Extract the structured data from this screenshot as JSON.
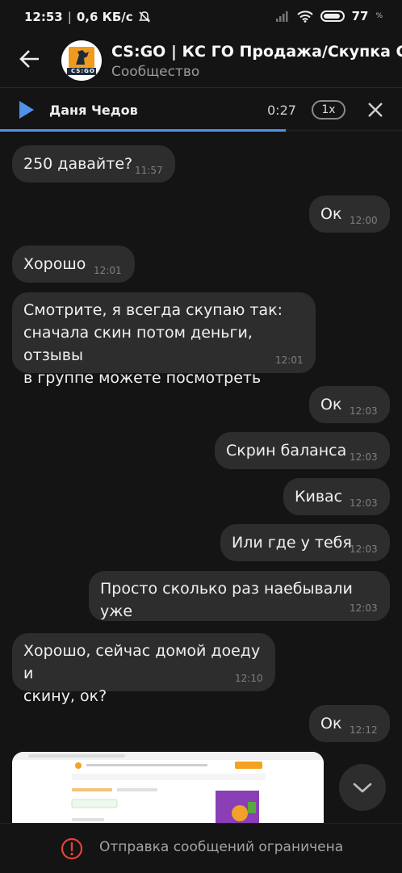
{
  "status_bar": {
    "time": "12:53",
    "speed": "0,6 КБ/с",
    "battery": "77",
    "battery_unit": "%"
  },
  "header": {
    "title": "CS:GO | КС ГО Продажа/Скупка СКИНОВ",
    "subtitle": "Сообщество",
    "avatar_text": "CS:GO"
  },
  "player": {
    "name": "Даня Чедов",
    "time": "0:27",
    "speed": "1x",
    "progress": 0.71
  },
  "messages": [
    {
      "text": "250 давайте?",
      "time": "11:57"
    },
    {
      "text": "Ок",
      "time": "12:00"
    },
    {
      "text": "Хорошо",
      "time": "12:01"
    },
    {
      "text": "Смотрите, я всегда скупаю так:\nсначала скин потом деньги, отзывы\nв группе можете посмотреть",
      "time": "12:01"
    },
    {
      "text": "Ок",
      "time": "12:03"
    },
    {
      "text": "Скрин баланса",
      "time": "12:03"
    },
    {
      "text": "Кивас",
      "time": "12:03"
    },
    {
      "text": "Или где у тебя",
      "time": "12:03"
    },
    {
      "text": "Просто сколько раз наебывали уже",
      "time": "12:03"
    },
    {
      "text": "Хорошо, сейчас домой доеду и\nскину, ок?",
      "time": "12:10"
    },
    {
      "text": "Ок",
      "time": "12:12"
    }
  ],
  "bottom": {
    "text": "Отправка сообщений ограничена"
  },
  "colors": {
    "accent": "#4f93e8",
    "bubble": "#2d2d2d",
    "background": "#141414",
    "warning": "#e0443a"
  }
}
